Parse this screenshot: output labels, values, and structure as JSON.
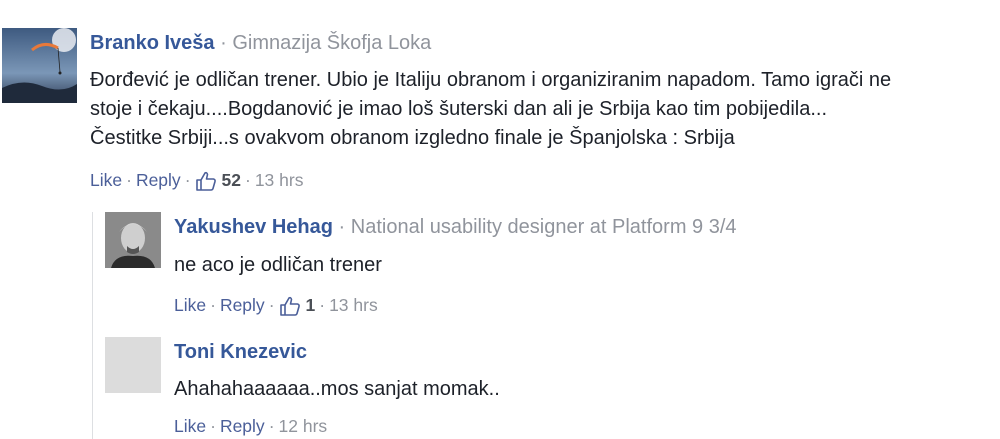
{
  "comments": [
    {
      "author": "Branko Iveša",
      "affiliation": "Gimnazija Škofja Loka",
      "text_lines": [
        "Đorđević je odličan trener. Ubio je Italiju obranom i organiziranim napadom. Tamo igrači ne",
        "stoje i čekaju....Bogdanović je imao loš šuterski dan ali je Srbija kao tim pobijedila...",
        "Čestitke Srbiji...s ovakvom obranom izgledno finale je Španjolska : Srbija"
      ],
      "like_label": "Like",
      "reply_label": "Reply",
      "like_count": "52",
      "time": "13 hrs"
    },
    {
      "author": "Yakushev Hehag",
      "affiliation": "National usability designer at Platform 9 3/4",
      "text_lines": [
        "ne aco je odličan trener"
      ],
      "like_label": "Like",
      "reply_label": "Reply",
      "like_count": "1",
      "time": "13 hrs"
    },
    {
      "author": "Toni Knezevic",
      "text_lines": [
        "Ahahahaaaaaa..mos sanjat momak.."
      ],
      "like_label": "Like",
      "reply_label": "Reply",
      "time": "12 hrs"
    }
  ],
  "separator": "·",
  "colors": {
    "author": "#365899",
    "meta": "#90949c",
    "link": "#4b5f99",
    "text": "#1d2129"
  },
  "icons": [
    "thumbs-up-icon"
  ]
}
